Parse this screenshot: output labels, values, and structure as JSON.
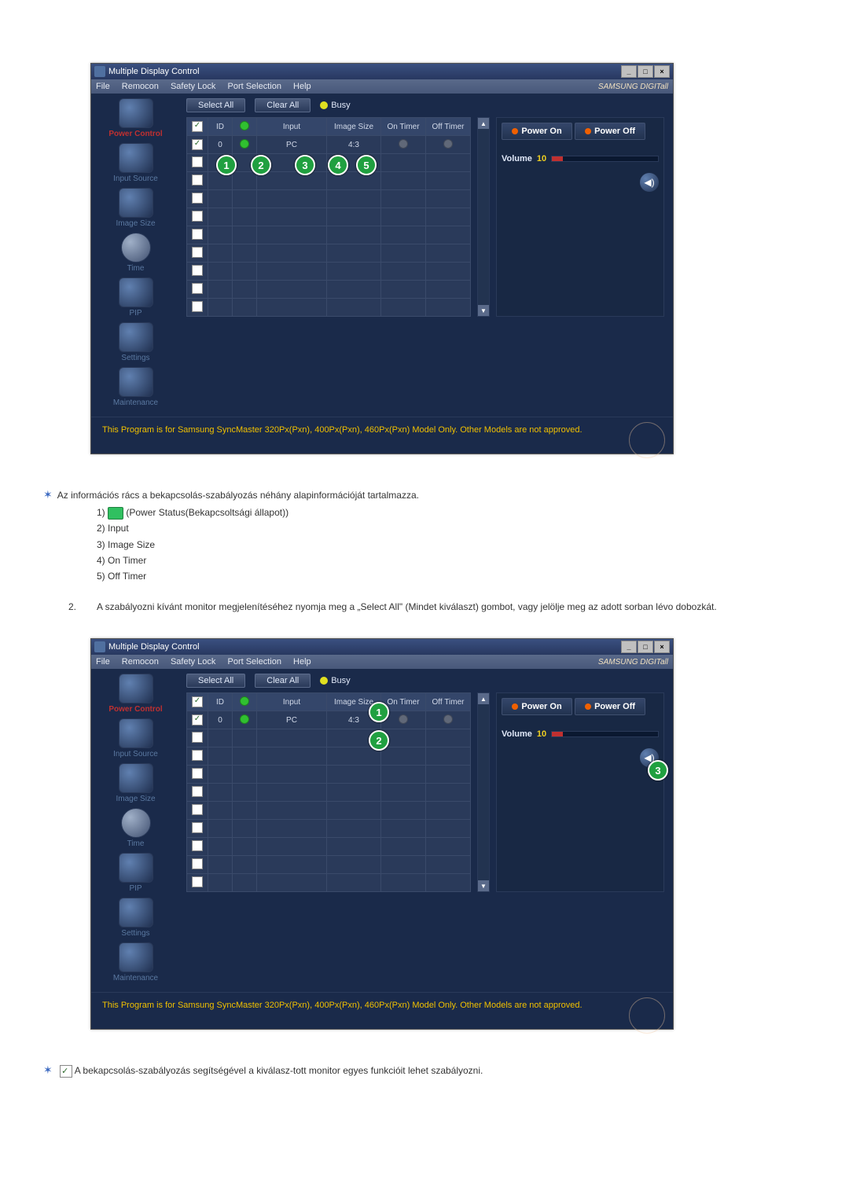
{
  "window": {
    "title": "Multiple Display Control",
    "brand": "SAMSUNG DIGITall"
  },
  "menu": {
    "file": "File",
    "remocon": "Remocon",
    "safety_lock": "Safety Lock",
    "port_selection": "Port Selection",
    "help": "Help"
  },
  "sidebar": {
    "power_control": "Power Control",
    "input_source": "Input Source",
    "image_size": "Image Size",
    "time": "Time",
    "pip": "PIP",
    "settings": "Settings",
    "maintenance": "Maintenance"
  },
  "toolbar": {
    "select_all": "Select All",
    "clear_all": "Clear All",
    "busy": "Busy"
  },
  "grid": {
    "headers": {
      "chk": "",
      "id": "ID",
      "stat": "",
      "input": "Input",
      "image_size": "Image Size",
      "on_timer": "On Timer",
      "off_timer": "Off Timer"
    },
    "row": {
      "id": "0",
      "input": "PC",
      "image_size": "4:3"
    }
  },
  "panel": {
    "power_on": "Power On",
    "power_off": "Power Off",
    "volume_label": "Volume",
    "volume_value": "10"
  },
  "footer": {
    "line": "This Program is for Samsung SyncMaster 320Px(Pxn), 400Px(Pxn), 460Px(Pxn)  Model Only. Other Models are not approved."
  },
  "doc1": {
    "intro": "Az információs rács a bekapcsolás-szabályozás néhány alapinformációját tartalmazza.",
    "l1a": "1) ",
    "l1b": " (Power Status(Bekapcsoltsági állapot))",
    "l2": "2) Input",
    "l3": "3) Image Size",
    "l4": "4) On Timer",
    "l5": "5) Off Timer",
    "p2_num": "2.",
    "p2": "A szabályozni kívánt monitor megjelenítéséhez nyomja meg a „Select All\" (Mindet kiválaszt) gombot, vagy jelölje meg az adott sorban lévo dobozkát."
  },
  "doc2": {
    "line": " A bekapcsolás-szabályozás segítségével a kiválasz-tott monitor egyes funkcióit lehet szabályozni."
  }
}
